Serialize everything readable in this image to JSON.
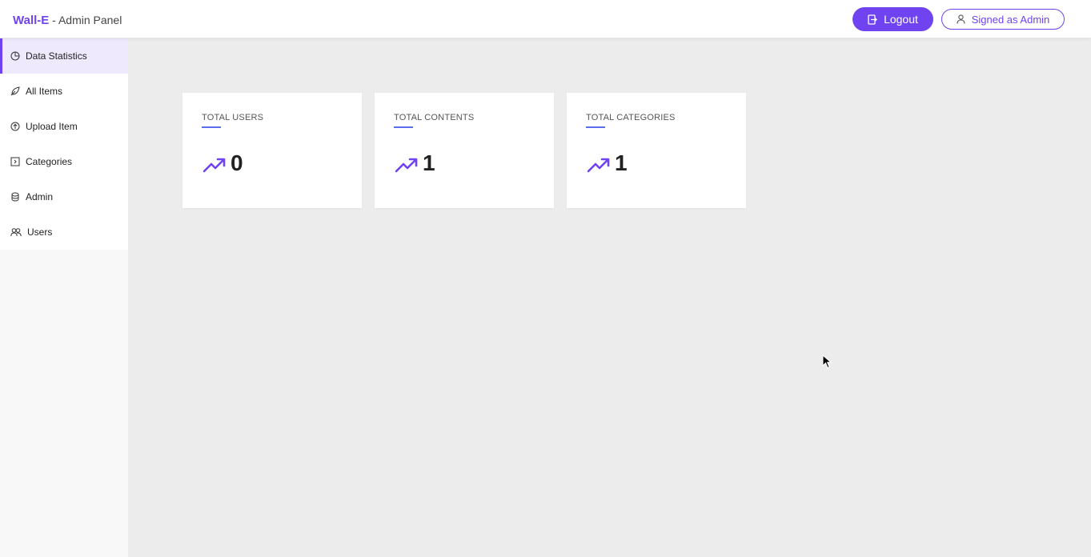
{
  "header": {
    "brand_name": "Wall-E",
    "brand_suffix": " - Admin Panel",
    "logout_label": "Logout",
    "logout_icon": "logout-icon",
    "signed_label": "Signed as Admin",
    "signed_icon": "user-icon"
  },
  "sidebar": {
    "items": [
      {
        "label": "Data Statistics",
        "icon": "pie-chart-icon",
        "active": true
      },
      {
        "label": "All Items",
        "icon": "leaf-icon",
        "active": false
      },
      {
        "label": "Upload Item",
        "icon": "upload-icon",
        "active": false
      },
      {
        "label": "Categories",
        "icon": "category-icon",
        "active": false
      },
      {
        "label": "Admin",
        "icon": "admin-icon",
        "active": false
      },
      {
        "label": "Users",
        "icon": "users-icon",
        "active": false
      }
    ]
  },
  "stats": [
    {
      "title": "TOTAL USERS",
      "value": "0",
      "icon": "trend-up-icon"
    },
    {
      "title": "TOTAL CONTENTS",
      "value": "1",
      "icon": "trend-up-icon"
    },
    {
      "title": "TOTAL CATEGORIES",
      "value": "1",
      "icon": "trend-up-icon"
    }
  ],
  "colors": {
    "accent": "#7043f0",
    "active_bg": "#efe9fd",
    "underline": "#5b6cf0",
    "background": "#ececec"
  }
}
